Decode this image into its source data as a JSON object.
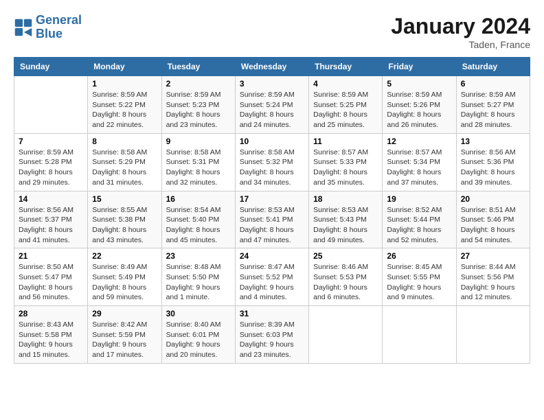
{
  "header": {
    "logo_line1": "General",
    "logo_line2": "Blue",
    "month_title": "January 2024",
    "location": "Taden, France"
  },
  "days_of_week": [
    "Sunday",
    "Monday",
    "Tuesday",
    "Wednesday",
    "Thursday",
    "Friday",
    "Saturday"
  ],
  "weeks": [
    [
      {
        "day": "",
        "sunrise": "",
        "sunset": "",
        "daylight": ""
      },
      {
        "day": "1",
        "sunrise": "Sunrise: 8:59 AM",
        "sunset": "Sunset: 5:22 PM",
        "daylight": "Daylight: 8 hours and 22 minutes."
      },
      {
        "day": "2",
        "sunrise": "Sunrise: 8:59 AM",
        "sunset": "Sunset: 5:23 PM",
        "daylight": "Daylight: 8 hours and 23 minutes."
      },
      {
        "day": "3",
        "sunrise": "Sunrise: 8:59 AM",
        "sunset": "Sunset: 5:24 PM",
        "daylight": "Daylight: 8 hours and 24 minutes."
      },
      {
        "day": "4",
        "sunrise": "Sunrise: 8:59 AM",
        "sunset": "Sunset: 5:25 PM",
        "daylight": "Daylight: 8 hours and 25 minutes."
      },
      {
        "day": "5",
        "sunrise": "Sunrise: 8:59 AM",
        "sunset": "Sunset: 5:26 PM",
        "daylight": "Daylight: 8 hours and 26 minutes."
      },
      {
        "day": "6",
        "sunrise": "Sunrise: 8:59 AM",
        "sunset": "Sunset: 5:27 PM",
        "daylight": "Daylight: 8 hours and 28 minutes."
      }
    ],
    [
      {
        "day": "7",
        "sunrise": "Sunrise: 8:59 AM",
        "sunset": "Sunset: 5:28 PM",
        "daylight": "Daylight: 8 hours and 29 minutes."
      },
      {
        "day": "8",
        "sunrise": "Sunrise: 8:58 AM",
        "sunset": "Sunset: 5:29 PM",
        "daylight": "Daylight: 8 hours and 31 minutes."
      },
      {
        "day": "9",
        "sunrise": "Sunrise: 8:58 AM",
        "sunset": "Sunset: 5:31 PM",
        "daylight": "Daylight: 8 hours and 32 minutes."
      },
      {
        "day": "10",
        "sunrise": "Sunrise: 8:58 AM",
        "sunset": "Sunset: 5:32 PM",
        "daylight": "Daylight: 8 hours and 34 minutes."
      },
      {
        "day": "11",
        "sunrise": "Sunrise: 8:57 AM",
        "sunset": "Sunset: 5:33 PM",
        "daylight": "Daylight: 8 hours and 35 minutes."
      },
      {
        "day": "12",
        "sunrise": "Sunrise: 8:57 AM",
        "sunset": "Sunset: 5:34 PM",
        "daylight": "Daylight: 8 hours and 37 minutes."
      },
      {
        "day": "13",
        "sunrise": "Sunrise: 8:56 AM",
        "sunset": "Sunset: 5:36 PM",
        "daylight": "Daylight: 8 hours and 39 minutes."
      }
    ],
    [
      {
        "day": "14",
        "sunrise": "Sunrise: 8:56 AM",
        "sunset": "Sunset: 5:37 PM",
        "daylight": "Daylight: 8 hours and 41 minutes."
      },
      {
        "day": "15",
        "sunrise": "Sunrise: 8:55 AM",
        "sunset": "Sunset: 5:38 PM",
        "daylight": "Daylight: 8 hours and 43 minutes."
      },
      {
        "day": "16",
        "sunrise": "Sunrise: 8:54 AM",
        "sunset": "Sunset: 5:40 PM",
        "daylight": "Daylight: 8 hours and 45 minutes."
      },
      {
        "day": "17",
        "sunrise": "Sunrise: 8:53 AM",
        "sunset": "Sunset: 5:41 PM",
        "daylight": "Daylight: 8 hours and 47 minutes."
      },
      {
        "day": "18",
        "sunrise": "Sunrise: 8:53 AM",
        "sunset": "Sunset: 5:43 PM",
        "daylight": "Daylight: 8 hours and 49 minutes."
      },
      {
        "day": "19",
        "sunrise": "Sunrise: 8:52 AM",
        "sunset": "Sunset: 5:44 PM",
        "daylight": "Daylight: 8 hours and 52 minutes."
      },
      {
        "day": "20",
        "sunrise": "Sunrise: 8:51 AM",
        "sunset": "Sunset: 5:46 PM",
        "daylight": "Daylight: 8 hours and 54 minutes."
      }
    ],
    [
      {
        "day": "21",
        "sunrise": "Sunrise: 8:50 AM",
        "sunset": "Sunset: 5:47 PM",
        "daylight": "Daylight: 8 hours and 56 minutes."
      },
      {
        "day": "22",
        "sunrise": "Sunrise: 8:49 AM",
        "sunset": "Sunset: 5:49 PM",
        "daylight": "Daylight: 8 hours and 59 minutes."
      },
      {
        "day": "23",
        "sunrise": "Sunrise: 8:48 AM",
        "sunset": "Sunset: 5:50 PM",
        "daylight": "Daylight: 9 hours and 1 minute."
      },
      {
        "day": "24",
        "sunrise": "Sunrise: 8:47 AM",
        "sunset": "Sunset: 5:52 PM",
        "daylight": "Daylight: 9 hours and 4 minutes."
      },
      {
        "day": "25",
        "sunrise": "Sunrise: 8:46 AM",
        "sunset": "Sunset: 5:53 PM",
        "daylight": "Daylight: 9 hours and 6 minutes."
      },
      {
        "day": "26",
        "sunrise": "Sunrise: 8:45 AM",
        "sunset": "Sunset: 5:55 PM",
        "daylight": "Daylight: 9 hours and 9 minutes."
      },
      {
        "day": "27",
        "sunrise": "Sunrise: 8:44 AM",
        "sunset": "Sunset: 5:56 PM",
        "daylight": "Daylight: 9 hours and 12 minutes."
      }
    ],
    [
      {
        "day": "28",
        "sunrise": "Sunrise: 8:43 AM",
        "sunset": "Sunset: 5:58 PM",
        "daylight": "Daylight: 9 hours and 15 minutes."
      },
      {
        "day": "29",
        "sunrise": "Sunrise: 8:42 AM",
        "sunset": "Sunset: 5:59 PM",
        "daylight": "Daylight: 9 hours and 17 minutes."
      },
      {
        "day": "30",
        "sunrise": "Sunrise: 8:40 AM",
        "sunset": "Sunset: 6:01 PM",
        "daylight": "Daylight: 9 hours and 20 minutes."
      },
      {
        "day": "31",
        "sunrise": "Sunrise: 8:39 AM",
        "sunset": "Sunset: 6:03 PM",
        "daylight": "Daylight: 9 hours and 23 minutes."
      },
      {
        "day": "",
        "sunrise": "",
        "sunset": "",
        "daylight": ""
      },
      {
        "day": "",
        "sunrise": "",
        "sunset": "",
        "daylight": ""
      },
      {
        "day": "",
        "sunrise": "",
        "sunset": "",
        "daylight": ""
      }
    ]
  ]
}
